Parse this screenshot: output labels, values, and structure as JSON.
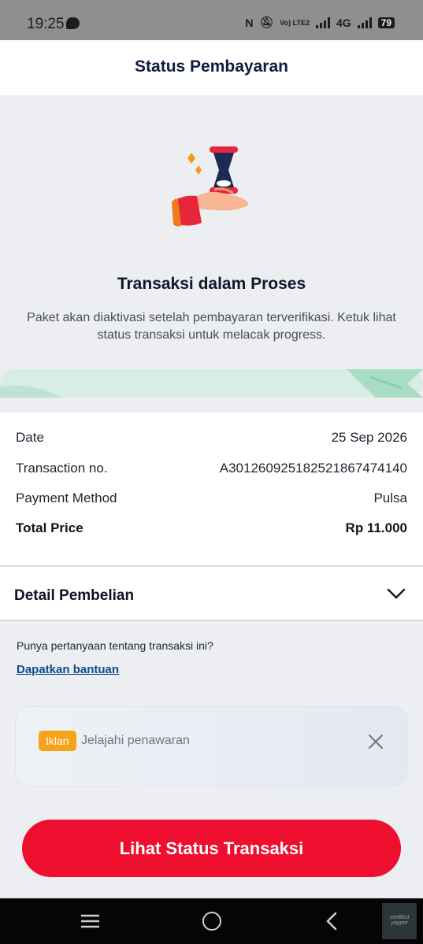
{
  "status_bar": {
    "time": "19:25",
    "volte": "Vo) LTE2",
    "network": "4G",
    "battery": "79"
  },
  "header": {
    "title": "Status Pembayaran"
  },
  "hero": {
    "title": "Transaksi dalam Proses",
    "description": "Paket akan diaktivasi setelah pembayaran terverifikasi. Ketuk lihat status transaksi untuk melacak progress.",
    "illustration_icon": "hand-holding-hourglass-icon"
  },
  "details": {
    "date_label": "Date",
    "date_value": "25 Sep 2026",
    "txn_label": "Transaction no.",
    "txn_value": "A301260925182521867474140",
    "method_label": "Payment Method",
    "method_value": "Pulsa",
    "total_label": "Total Price",
    "total_value": "Rp 11.000"
  },
  "accordion": {
    "label": "Detail Pembelian",
    "icon": "chevron-down-icon"
  },
  "help": {
    "question": "Punya pertanyaan tentang transaksi ini?",
    "link": "Dapatkan bantuan"
  },
  "ad": {
    "badge": "Iklan",
    "text": "Jelajahi penawaran",
    "close_icon": "close-icon"
  },
  "cta": {
    "label": "Lihat Status Transaksi"
  },
  "nav_bar": {
    "icons": [
      "menu-icon",
      "home-icon",
      "back-icon"
    ],
    "watermark": "certified yapper"
  },
  "colors": {
    "brand_red": "#ee0f2e",
    "ad_badge": "#f6a319",
    "link_blue": "#0b4a8a",
    "title_navy": "#0f1c3d"
  }
}
